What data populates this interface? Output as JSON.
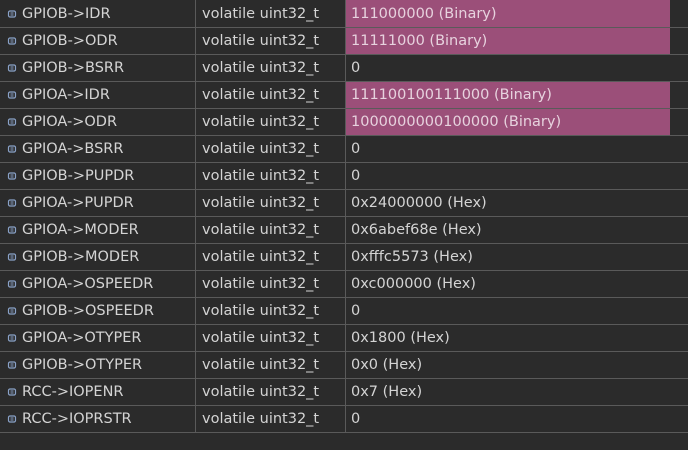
{
  "colors": {
    "background": "#2b2b2b",
    "grid_line": "#5a5a5a",
    "text": "#d4d4d4",
    "changed_value_bg": "#9b4f79",
    "changed_value_text": "#e7d2de",
    "icon": "#8aa2c8"
  },
  "rows": [
    {
      "icon": "watch-variable-icon",
      "expression": "GPIOB->IDR",
      "type": "volatile uint32_t",
      "value": "111000000 (Binary)",
      "changed": true
    },
    {
      "icon": "watch-variable-icon",
      "expression": "GPIOB->ODR",
      "type": "volatile uint32_t",
      "value": "11111000 (Binary)",
      "changed": true
    },
    {
      "icon": "watch-variable-icon",
      "expression": "GPIOB->BSRR",
      "type": "volatile uint32_t",
      "value": "0",
      "changed": false
    },
    {
      "icon": "watch-variable-icon",
      "expression": "GPIOA->IDR",
      "type": "volatile uint32_t",
      "value": "111100100111000 (Binary)",
      "changed": true
    },
    {
      "icon": "watch-variable-icon",
      "expression": "GPIOA->ODR",
      "type": "volatile uint32_t",
      "value": "1000000000100000 (Binary)",
      "changed": true
    },
    {
      "icon": "watch-variable-icon",
      "expression": "GPIOA->BSRR",
      "type": "volatile uint32_t",
      "value": "0",
      "changed": false
    },
    {
      "icon": "watch-variable-icon",
      "expression": "GPIOB->PUPDR",
      "type": "volatile uint32_t",
      "value": "0",
      "changed": false
    },
    {
      "icon": "watch-variable-icon",
      "expression": "GPIOA->PUPDR",
      "type": "volatile uint32_t",
      "value": "0x24000000 (Hex)",
      "changed": false
    },
    {
      "icon": "watch-variable-icon",
      "expression": "GPIOA->MODER",
      "type": "volatile uint32_t",
      "value": "0x6abef68e (Hex)",
      "changed": false
    },
    {
      "icon": "watch-variable-icon",
      "expression": "GPIOB->MODER",
      "type": "volatile uint32_t",
      "value": "0xfffc5573 (Hex)",
      "changed": false
    },
    {
      "icon": "watch-variable-icon",
      "expression": "GPIOA->OSPEEDR",
      "type": "volatile uint32_t",
      "value": "0xc000000 (Hex)",
      "changed": false
    },
    {
      "icon": "watch-variable-icon",
      "expression": "GPIOB->OSPEEDR",
      "type": "volatile uint32_t",
      "value": "0",
      "changed": false
    },
    {
      "icon": "watch-variable-icon",
      "expression": "GPIOA->OTYPER",
      "type": "volatile uint32_t",
      "value": "0x1800 (Hex)",
      "changed": false
    },
    {
      "icon": "watch-variable-icon",
      "expression": "GPIOB->OTYPER",
      "type": "volatile uint32_t",
      "value": "0x0 (Hex)",
      "changed": false
    },
    {
      "icon": "watch-variable-icon",
      "expression": "RCC->IOPENR",
      "type": "volatile uint32_t",
      "value": "0x7 (Hex)",
      "changed": false
    },
    {
      "icon": "watch-variable-icon",
      "expression": "RCC->IOPRSTR",
      "type": "volatile uint32_t",
      "value": "0",
      "changed": false
    }
  ]
}
